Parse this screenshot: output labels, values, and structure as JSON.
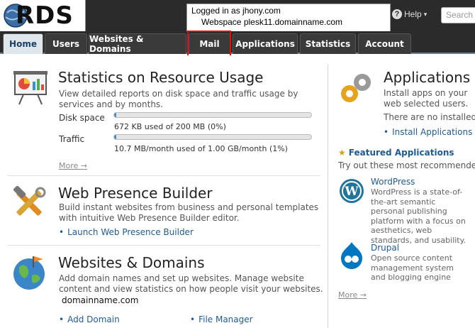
{
  "header": {
    "logo_text": "RDS",
    "login_line1": "Logged in as jhony.com",
    "login_line2": "Webspace plesk11.domainname.com",
    "help_label": "Help",
    "search_placeholder": "Search"
  },
  "tabs": [
    {
      "label": "Home",
      "active": true
    },
    {
      "label": "Users"
    },
    {
      "label": "Websites & Domains"
    },
    {
      "label": "Mail"
    },
    {
      "label": "Applications"
    },
    {
      "label": "Statistics"
    },
    {
      "label": "Account"
    }
  ],
  "stats": {
    "title": "Statistics on Resource Usage",
    "description": "View detailed reports on disk space and traffic usage by services and by months.",
    "disk_label": "Disk space",
    "disk_usage": "672 KB used of 200 MB (0%)",
    "disk_fraction": 0.0,
    "traffic_label": "Traffic",
    "traffic_usage": "10.7 MB/month used of 1.00 GB/month (1%)",
    "traffic_fraction": 0.01,
    "more": "More →"
  },
  "builder": {
    "title": "Web Presence Builder",
    "description": "Build instant websites from business and personal templates with intuitive Web Presence Builder editor.",
    "link": "Launch Web Presence Builder"
  },
  "websites": {
    "title": "Websites & Domains",
    "description": "Add domain names and set up websites. Manage website content and view statistics on how people visit your websites.",
    "domain": "domainname.com",
    "link_add": "Add Domain",
    "link_files": "File Manager"
  },
  "applications": {
    "title": "Applications",
    "description": "Install apps on your web selected users.",
    "none": "There are no installed",
    "link": "Install Applications",
    "featured_title": "Featured Applications",
    "featured_desc": "Try out these most recommended",
    "apps": [
      {
        "name": "WordPress",
        "desc": "WordPress is a state-of-the-art semantic personal publishing platform with a focus on aesthetics, web standards, and usability."
      },
      {
        "name": "Drupal",
        "desc": "Open source content management system and blogging engine"
      }
    ],
    "more": "More →"
  },
  "colors": {
    "accent": "#1f5b94",
    "bar_fill": "#3f8fcf",
    "header_bg": "#2b2b2b"
  }
}
